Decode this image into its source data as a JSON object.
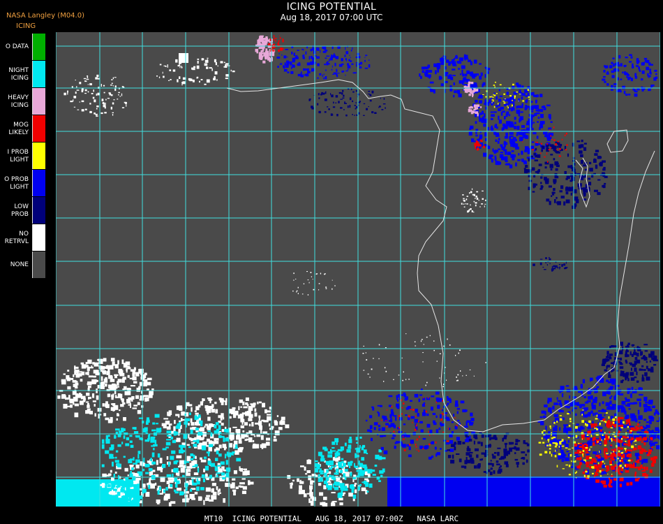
{
  "header": {
    "title": "ICING POTENTIAL",
    "timestamp": "Aug 18, 2017 07:00 UTC",
    "org": "NASA Langley (M04.0)",
    "product": "ICING"
  },
  "legend": [
    {
      "label": "O DATA",
      "color": "#00b000"
    },
    {
      "label": "NIGHT\nICING",
      "color": "#00e8f0"
    },
    {
      "label": "HEAVY\nICING",
      "color": "#e8a8d8"
    },
    {
      "label": "MOG\nLIKELY",
      "color": "#f00000"
    },
    {
      "label": "I PROB\nLIGHT",
      "color": "#ffff00"
    },
    {
      "label": "O PROB\nLIGHT",
      "color": "#0000f0"
    },
    {
      "label": "LOW\nPROB",
      "color": "#00007a"
    },
    {
      "label": "NO\nRETRVL",
      "color": "#ffffff"
    },
    {
      "label": "NONE",
      "color": "#4a4a4a"
    }
  ],
  "colors": {
    "map_background": "#4a4a4a",
    "grid": "#40e0e0",
    "coastline": "#e6e6e6",
    "grid_label": "#b02020",
    "no_retrieval": "#ffffff",
    "night_icing": "#00e8f0",
    "low_prob": "#00007a",
    "prob_light_blue": "#0000f0",
    "prob_light_yellow": "#ffff00",
    "mog_likely": "#f00000",
    "heavy_icing": "#e8a8d8"
  },
  "footer": "MT10  ICING POTENTIAL   AUG 18, 2017 07:00Z   NASA LARC"
}
